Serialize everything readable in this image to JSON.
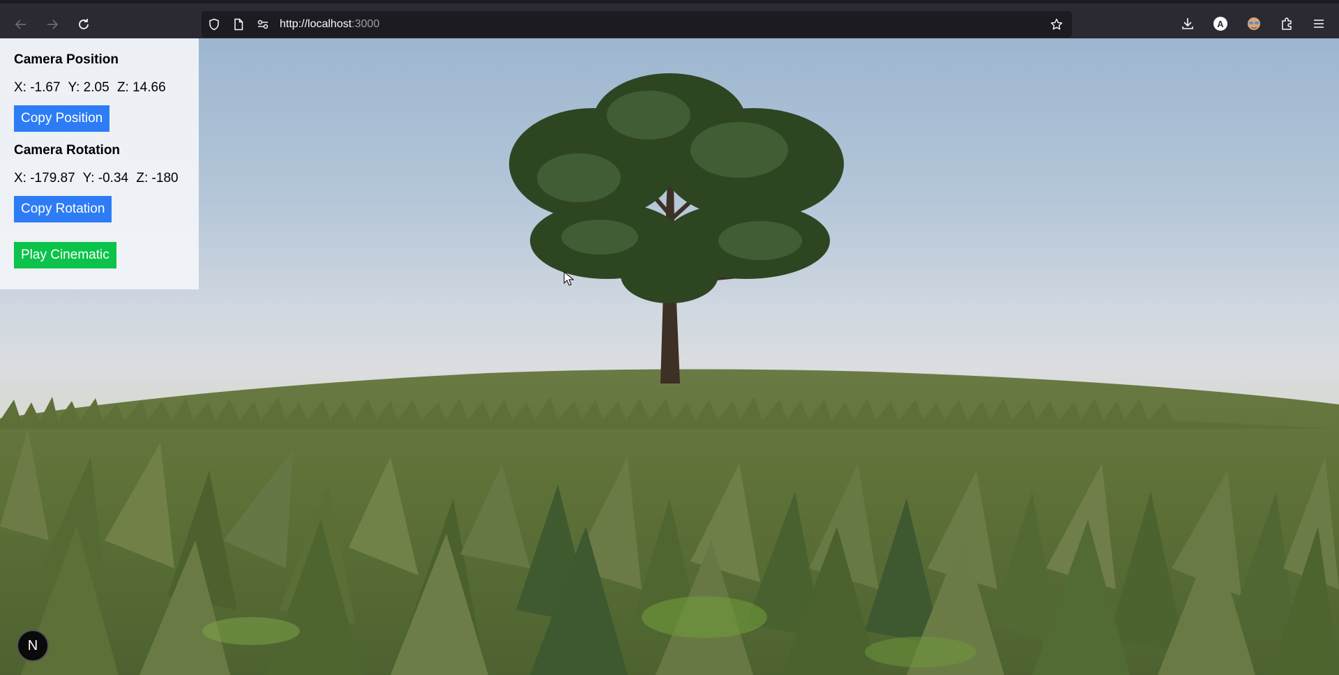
{
  "browser": {
    "url_host": "http://localhost",
    "url_port": ":3000",
    "account_initial": "A",
    "icons": {
      "back": "arrow-left-icon",
      "forward": "arrow-right-icon",
      "reload": "reload-icon",
      "shield": "shield-icon",
      "page": "page-icon",
      "permissions": "permissions-icon",
      "bookmark": "star-icon",
      "downloads": "download-icon",
      "extension": "extension-face-icon",
      "extensions": "puzzle-icon",
      "menu": "hamburger-menu-icon"
    }
  },
  "panel": {
    "position_heading": "Camera Position",
    "position": {
      "x": "X: -1.67",
      "y": "Y: 2.05",
      "z": "Z: 14.66"
    },
    "copy_position_label": "Copy Position",
    "rotation_heading": "Camera Rotation",
    "rotation": {
      "x": "X: -179.87",
      "y": "Y: -0.34",
      "z": "Z: -180"
    },
    "copy_rotation_label": "Copy Rotation",
    "play_label": "Play Cinematic"
  },
  "badge": {
    "label": "N"
  },
  "colors": {
    "button_blue": "#2d7cf6",
    "button_green": "#0bc34a",
    "chrome": "#2b2a33",
    "sky_top": "#9db6d0",
    "grass": "#5b6e3a"
  }
}
